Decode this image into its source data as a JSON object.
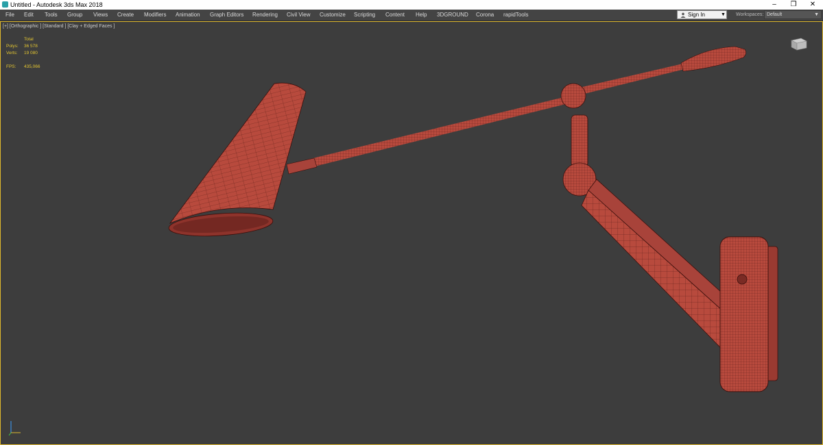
{
  "window": {
    "title": "Untitled - Autodesk 3ds Max 2018",
    "controls": [
      "minimize-icon",
      "restore-icon",
      "close-icon"
    ]
  },
  "menu": [
    {
      "label": "File"
    },
    {
      "label": "Edit"
    },
    {
      "label": "Tools"
    },
    {
      "label": "Group"
    },
    {
      "label": "Views"
    },
    {
      "label": "Create"
    },
    {
      "label": "Modifiers"
    },
    {
      "label": "Animation"
    },
    {
      "label": "Graph Editors"
    },
    {
      "label": "Rendering"
    },
    {
      "label": "Civil View"
    },
    {
      "label": "Customize"
    },
    {
      "label": "Scripting"
    },
    {
      "label": "Content"
    },
    {
      "label": "Help"
    },
    {
      "label": "3DGROUND"
    },
    {
      "label": "Corona"
    },
    {
      "label": "rapidTools"
    }
  ],
  "account": {
    "sign_in_label": "Sign In",
    "icon": "user-icon"
  },
  "workspaces": {
    "label": "Workspaces:",
    "value": "Default"
  },
  "viewport": {
    "label": "[+] [Orthographic ] [Standard ] [Clay + Edged Faces ]",
    "stats": {
      "header": "Total",
      "polys_label": "Polys:",
      "polys_value": "36 578",
      "verts_label": "Verts:",
      "verts_value": "19 080",
      "fps_label": "FPS:",
      "fps_value": "435,066"
    },
    "model_color": "#b84a3d",
    "wire_color": "#3a0f0c",
    "background_color": "#3d3d3d",
    "active_border_color": "#e0b92e"
  }
}
